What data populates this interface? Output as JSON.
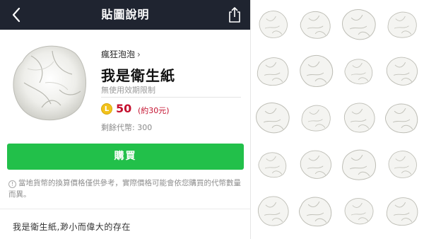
{
  "header": {
    "title": "貼圖說明",
    "back_icon": "chevron-left-icon",
    "share_icon": "share-icon",
    "bar_color": "#1f2430"
  },
  "product": {
    "author": "瘋狂泡泡",
    "name": "我是衛生紙",
    "validity": "無使用效期限制",
    "coin_symbol": "L",
    "price": "50",
    "price_approx": "(約30元)",
    "balance": "剩餘代幣: 300",
    "price_color": "#c4112f"
  },
  "actions": {
    "buy_label": "購買",
    "buy_color": "#22c04a"
  },
  "notice": {
    "icon": "info-icon",
    "text": "當地貨幣的換算價格僅供參考，實際價格可能會依您購買的代幣數量而異。"
  },
  "description": "我是衛生紙,渺小而偉大的存在",
  "sticker_grid": {
    "columns": 4,
    "rows": 5,
    "sticker_icon": "crumpled-tissue-sticker"
  }
}
